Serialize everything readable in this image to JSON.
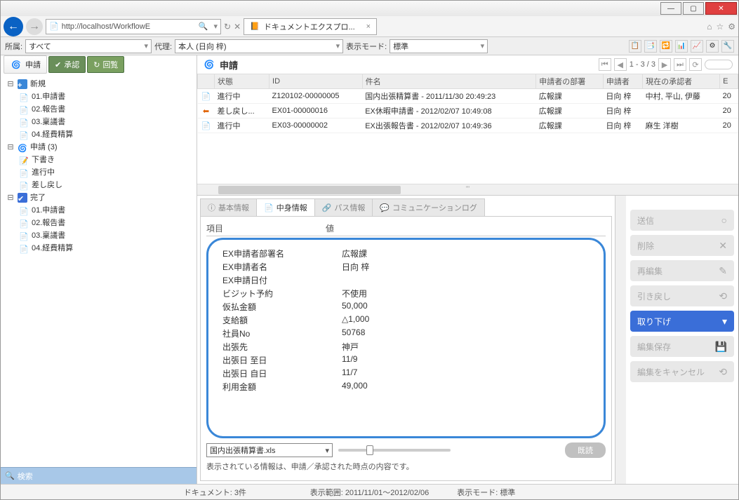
{
  "window": {
    "url": "http://localhost/WorkflowE",
    "tab_title": "ドキュメントエクスプロ...",
    "search_sym": "🔍"
  },
  "filter": {
    "affil_label": "所属:",
    "affil_value": "すべて",
    "proxy_label": "代理:",
    "proxy_value": "本人 (日向 梓)",
    "mode_label": "表示モード:",
    "mode_value": "標準"
  },
  "sidebar": {
    "tabs": {
      "apply": "申請",
      "approve": "承認",
      "circulate": "回覧"
    },
    "tree": {
      "new": "新規",
      "new_items": [
        "01.申請書",
        "02.報告書",
        "03.稟議書",
        "04.経費精算"
      ],
      "apply": "申請 (3)",
      "apply_items": [
        "下書き",
        "進行中",
        "差し戻し"
      ],
      "done": "完了",
      "done_items": [
        "01.申請書",
        "02.報告書",
        "03.稟議書",
        "04.経費精算"
      ]
    },
    "search": "検索"
  },
  "list": {
    "title": "申請",
    "pager": "1 - 3 / 3",
    "columns": [
      "",
      "状態",
      "ID",
      "件名",
      "申請者の部署",
      "申請者",
      "現在の承認者",
      "E"
    ],
    "rows": [
      {
        "icon": "doc",
        "status": "進行中",
        "id": "Z120102-00000005",
        "subject": "国内出張精算書 - 2011/11/30 20:49:23",
        "dept": "広報課",
        "requester": "日向 梓",
        "approver": "中村, 平山, 伊藤",
        "e": "20"
      },
      {
        "icon": "return",
        "status": "差し戻し...",
        "id": "EX01-00000016",
        "subject": "EX休暇申請書 - 2012/02/07 10:49:08",
        "dept": "広報課",
        "requester": "日向 梓",
        "approver": "",
        "e": "20"
      },
      {
        "icon": "doc",
        "status": "進行中",
        "id": "EX03-00000002",
        "subject": "EX出張報告書 - 2012/02/07 10:49:36",
        "dept": "広報課",
        "requester": "日向 梓",
        "approver": "麻生 洋樹",
        "e": "20"
      }
    ]
  },
  "detail": {
    "tabs": {
      "basic": "基本情報",
      "content": "中身情報",
      "path": "パス情報",
      "comm": "コミュニケーションログ"
    },
    "header_key": "項目",
    "header_val": "値",
    "rows": [
      {
        "k": "EX申請者部署名",
        "v": "広報課"
      },
      {
        "k": "EX申請者名",
        "v": "日向 梓"
      },
      {
        "k": "EX申請日付",
        "v": ""
      },
      {
        "k": "ビジット予約",
        "v": "不使用"
      },
      {
        "k": "仮払金額",
        "v": "50,000"
      },
      {
        "k": "支給額",
        "v": "△1,000"
      },
      {
        "k": "社員No",
        "v": "50768"
      },
      {
        "k": "出張先",
        "v": "神戸"
      },
      {
        "k": "出張日 至日",
        "v": "11/9"
      },
      {
        "k": "出張日 自日",
        "v": "11/7"
      },
      {
        "k": "利用金額",
        "v": "49,000"
      }
    ],
    "file": "国内出張精算書.xls",
    "read_btn": "既読",
    "footer": "表示されている情報は、申請／承認された時点の内容です。"
  },
  "actions": {
    "send": "送信",
    "delete": "削除",
    "reedit": "再編集",
    "pullback": "引き戻し",
    "withdraw": "取り下げ",
    "save": "編集保存",
    "cancel": "編集をキャンセル"
  },
  "status": {
    "docs": "ドキュメント: 3件",
    "range": "表示範囲: 2011/11/01～2012/02/06",
    "mode": "表示モード: 標準"
  }
}
